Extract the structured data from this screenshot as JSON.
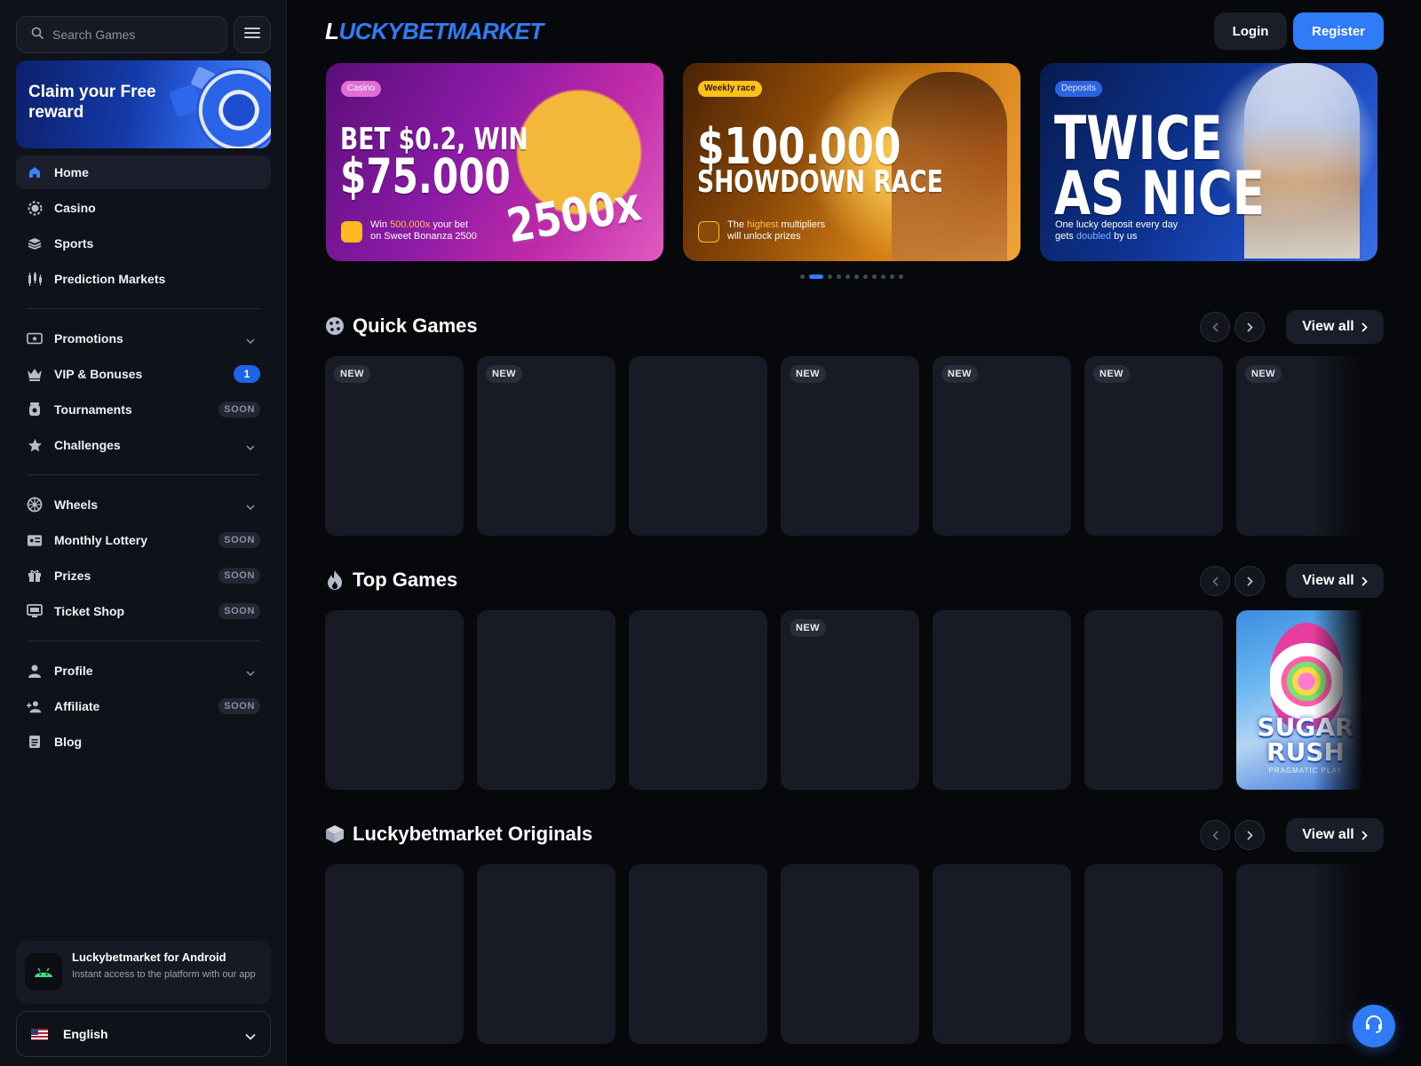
{
  "sidebar": {
    "search": {
      "placeholder": "Search Games"
    },
    "promo": {
      "title": "Claim your Free reward"
    },
    "items": [
      {
        "label": "Home",
        "icon": "home-icon",
        "active": true
      },
      {
        "label": "Casino",
        "icon": "casino-chip-icon"
      },
      {
        "label": "Sports",
        "icon": "sports-icon"
      },
      {
        "label": "Prediction Markets",
        "icon": "candlestick-icon"
      },
      {
        "label": "Promotions",
        "icon": "ticket-star-icon",
        "expandable": true
      },
      {
        "label": "VIP & Bonuses",
        "icon": "crown-icon",
        "badge": "1"
      },
      {
        "label": "Tournaments",
        "icon": "trophy-icon",
        "badge": "SOON"
      },
      {
        "label": "Challenges",
        "icon": "star-icon",
        "expandable": true
      },
      {
        "label": "Wheels",
        "icon": "wheel-icon",
        "expandable": true
      },
      {
        "label": "Monthly Lottery",
        "icon": "lottery-ticket-icon",
        "badge": "SOON"
      },
      {
        "label": "Prizes",
        "icon": "gift-icon",
        "badge": "SOON"
      },
      {
        "label": "Ticket Shop",
        "icon": "monitor-icon",
        "badge": "SOON"
      },
      {
        "label": "Profile",
        "icon": "user-icon",
        "expandable": true
      },
      {
        "label": "Affiliate",
        "icon": "user-add-icon",
        "badge": "SOON"
      },
      {
        "label": "Blog",
        "icon": "document-icon"
      }
    ],
    "android": {
      "title": "Luckybetmarket for Android",
      "desc": "Instant access to the platform with our app"
    },
    "language": {
      "label": "English"
    }
  },
  "header": {
    "logo_first": "L",
    "logo_rest": "UCKYBETMARKET",
    "login": "Login",
    "register": "Register"
  },
  "heroes": [
    {
      "tag": "Casino",
      "line1": "BET $0.2, WIN",
      "line2": "$75.000",
      "multiplier": "2500x",
      "sub_a": "Win ",
      "sub_hl": "500.000x",
      "sub_b": " your bet",
      "sub_c": "on Sweet Bonanza 2500"
    },
    {
      "tag": "Weekly race",
      "line1": "$100.000",
      "line2": "SHOWDOWN RACE",
      "sub_a": "The ",
      "sub_hl": "highest",
      "sub_b": " multipliers",
      "sub_c": "will unlock prizes"
    },
    {
      "tag": "Deposits",
      "line1": "TWICE",
      "line2": "AS NICE",
      "sub_a": "One lucky deposit every day",
      "sub_b": "gets ",
      "sub_hl": "doubled",
      "sub_c": " by us"
    }
  ],
  "sections": {
    "quick": {
      "title": "Quick Games",
      "icon": "dice-icon",
      "view_all": "View all"
    },
    "top": {
      "title": "Top Games",
      "icon": "fire-icon",
      "view_all": "View all"
    },
    "originals": {
      "title": "Luckybetmarket Originals",
      "icon": "cube-icon",
      "view_all": "View all"
    }
  },
  "cards": {
    "new_label": "NEW",
    "sugar_rush": {
      "title": "SUGAR RUSH",
      "provider": "PRAGMATIC PLAY"
    }
  },
  "carousel_dots": 12,
  "colors": {
    "accent": "#2f7cf6",
    "bg": "#07080c",
    "sidebar": "#10121a",
    "card": "#181b25"
  }
}
